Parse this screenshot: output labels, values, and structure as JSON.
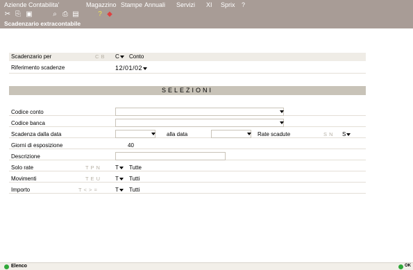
{
  "menu": [
    "Aziende",
    "Contabilita'",
    "Magazzino",
    "Stampe",
    "Annuali",
    "Servizi",
    "XI",
    "Sprix",
    "?"
  ],
  "window_title": "Scadenzario extracontabile",
  "fields": {
    "scadenzario_per": {
      "label": "Scadenzario per",
      "options": "C B",
      "value": "C",
      "desc": "Conto"
    },
    "riferimento": {
      "label": "Riferimento scadenze",
      "value": "12/01/02"
    }
  },
  "section_title": "SELEZIONI",
  "selezioni": {
    "codice_conto": {
      "label": "Codice conto",
      "value": ""
    },
    "codice_banca": {
      "label": "Codice banca",
      "value": ""
    },
    "scadenza": {
      "label": "Scadenza dalla data",
      "value": "",
      "alla_label": "alla data",
      "alla_value": "",
      "rate_label": "Rate scadute",
      "rate_options": "S N",
      "rate_value": "S"
    },
    "giorni": {
      "label": "Giorni di esposizione",
      "value": "40"
    },
    "descrizione": {
      "label": "Descrizione",
      "value": ""
    },
    "solo_rate": {
      "label": "Solo rate",
      "options": "T P N",
      "value": "T",
      "desc": "Tutte"
    },
    "movimenti": {
      "label": "Movimenti",
      "options": "T E U",
      "value": "T",
      "desc": "Tutti"
    },
    "importo": {
      "label": "Importo",
      "options": "T < > =",
      "value": "T",
      "desc": "Tutti"
    }
  },
  "status": {
    "left": "Elenco",
    "right": "OK"
  },
  "colors": {
    "menubar": "#a89c96",
    "section_bar": "#c8c3b8",
    "status_ok": "#2fa83a"
  }
}
